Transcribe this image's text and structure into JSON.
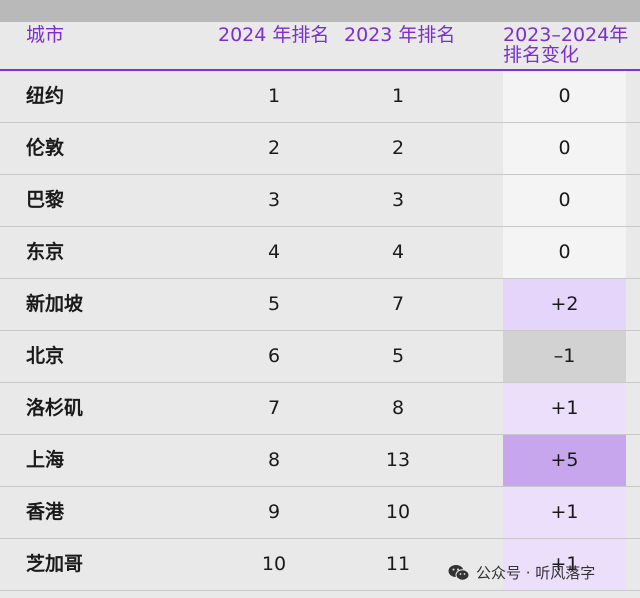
{
  "header": {
    "city": "城市",
    "rank_2024": "2024 年排名",
    "rank_2023": "2023 年排名",
    "change_line1": "2023–2024年",
    "change_line2": "排名变化"
  },
  "rows": [
    {
      "city": "纽约",
      "r2024": "1",
      "r2023": "1",
      "change": "0",
      "change_bg": "#f4f4f4"
    },
    {
      "city": "伦敦",
      "r2024": "2",
      "r2023": "2",
      "change": "0",
      "change_bg": "#f4f4f4"
    },
    {
      "city": "巴黎",
      "r2024": "3",
      "r2023": "3",
      "change": "0",
      "change_bg": "#f4f4f4"
    },
    {
      "city": "东京",
      "r2024": "4",
      "r2023": "4",
      "change": "0",
      "change_bg": "#f4f4f4"
    },
    {
      "city": "新加坡",
      "r2024": "5",
      "r2023": "7",
      "change": "+2",
      "change_bg": "#e6d5fa"
    },
    {
      "city": "北京",
      "r2024": "6",
      "r2023": "5",
      "change": "–1",
      "change_bg": "#d2d2d2"
    },
    {
      "city": "洛杉矶",
      "r2024": "7",
      "r2023": "8",
      "change": "+1",
      "change_bg": "#ecdffb"
    },
    {
      "city": "上海",
      "r2024": "8",
      "r2023": "13",
      "change": "+5",
      "change_bg": "#c7a6ee"
    },
    {
      "city": "香港",
      "r2024": "9",
      "r2023": "10",
      "change": "+1",
      "change_bg": "#ecdffb"
    },
    {
      "city": "芝加哥",
      "r2024": "10",
      "r2023": "11",
      "change": "+1",
      "change_bg": "#ecdffb"
    }
  ],
  "watermark": {
    "icon": "wechat-icon",
    "text": "公众号 · 听风落字"
  }
}
